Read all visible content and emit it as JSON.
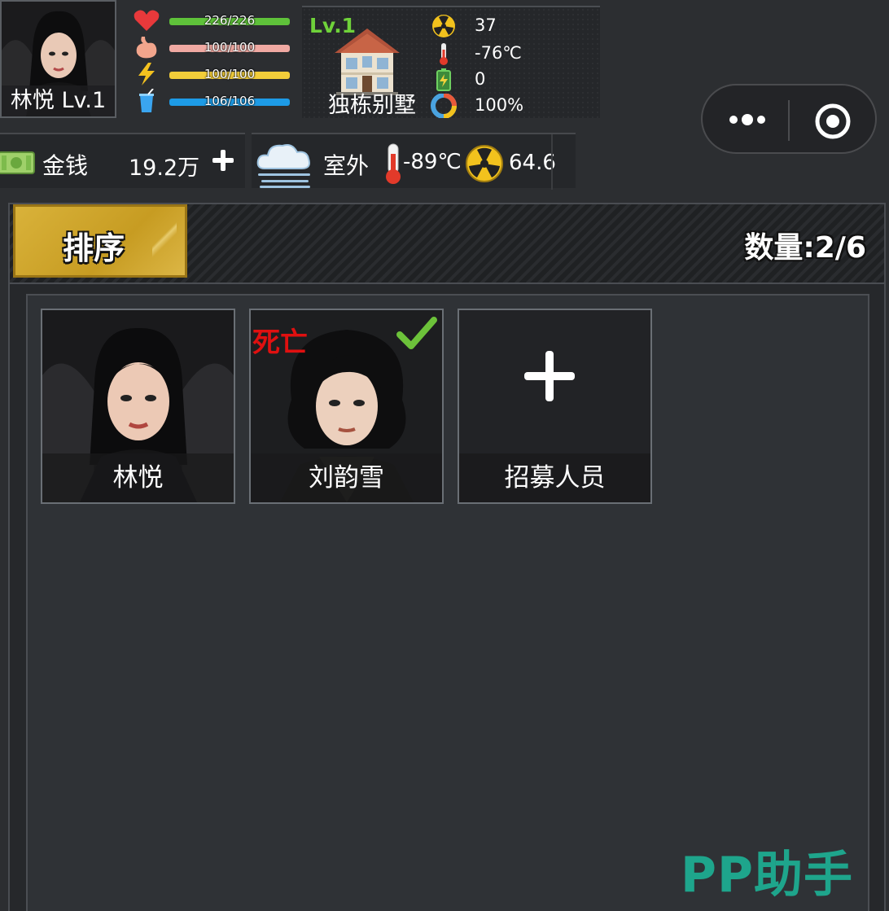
{
  "player": {
    "avatar_label": "林悦 Lv.1"
  },
  "vitals": [
    {
      "icon": "heart-icon",
      "text": "226/226",
      "fraction": 1.0,
      "color": "#5fc23a"
    },
    {
      "icon": "stomach-icon",
      "text": "100/100",
      "fraction": 1.0,
      "color": "#f0a9a2"
    },
    {
      "icon": "energy-icon",
      "text": "100/100",
      "fraction": 1.0,
      "color": "#f2cd3a"
    },
    {
      "icon": "water-cup-icon",
      "text": "106/106",
      "fraction": 1.0,
      "color": "#1d9be6"
    }
  ],
  "house": {
    "level": "Lv.1",
    "name": "独栋别墅",
    "stats": [
      {
        "icon": "radiation-icon",
        "value": "37"
      },
      {
        "icon": "thermometer-icon",
        "value": "-76℃"
      },
      {
        "icon": "battery-icon",
        "value": "0"
      },
      {
        "icon": "pie-icon",
        "value": "100%"
      }
    ]
  },
  "money": {
    "label": "金钱",
    "value": "19.2万"
  },
  "weather": {
    "location": "室外",
    "temperature": "-89℃",
    "radiation": "64.6"
  },
  "panel": {
    "sort_label": "排序",
    "count_label": "数量:2/6"
  },
  "members": [
    {
      "name": "林悦",
      "dead": false,
      "selected": false
    },
    {
      "name": "刘韵雪",
      "dead": true,
      "dead_label": "死亡",
      "selected": true
    }
  ],
  "recruit": {
    "label": "招募人员"
  },
  "watermark": "PP助手"
}
